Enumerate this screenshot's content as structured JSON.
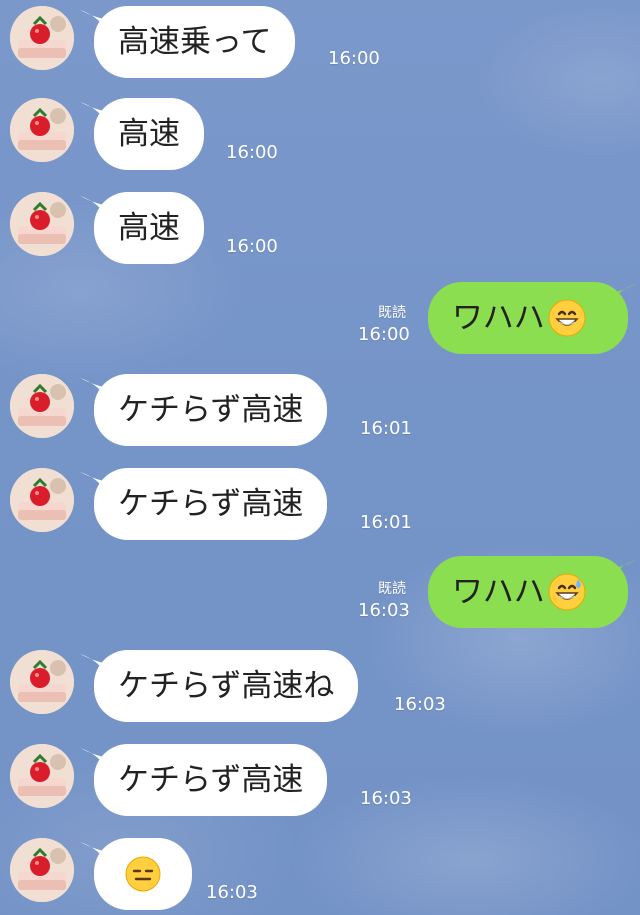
{
  "messages": [
    {
      "side": "left",
      "text": "高速乗って",
      "time": "16:00"
    },
    {
      "side": "left",
      "text": "高速",
      "time": "16:00"
    },
    {
      "side": "left",
      "text": "高速",
      "time": "16:00"
    },
    {
      "side": "right",
      "text": "ワハハ",
      "emoji": "grinning-face-icon",
      "read_label": "既読",
      "time": "16:00"
    },
    {
      "side": "left",
      "text": "ケチらず高速",
      "time": "16:01"
    },
    {
      "side": "left",
      "text": "ケチらず高速",
      "time": "16:01"
    },
    {
      "side": "right",
      "text": "ワハハ",
      "emoji": "grinning-sweat-face-icon",
      "read_label": "既読",
      "time": "16:03"
    },
    {
      "side": "left",
      "text": "ケチらず高速ね",
      "time": "16:03"
    },
    {
      "side": "left",
      "text": "ケチらず高速",
      "time": "16:03"
    },
    {
      "side": "left",
      "text": "",
      "emoji": "expressionless-face-icon",
      "time": "16:03"
    }
  ],
  "colors": {
    "background": "#7594c8",
    "incoming_bubble": "#ffffff",
    "outgoing_bubble": "#8bde4f",
    "meta_text": "#ffffff"
  }
}
